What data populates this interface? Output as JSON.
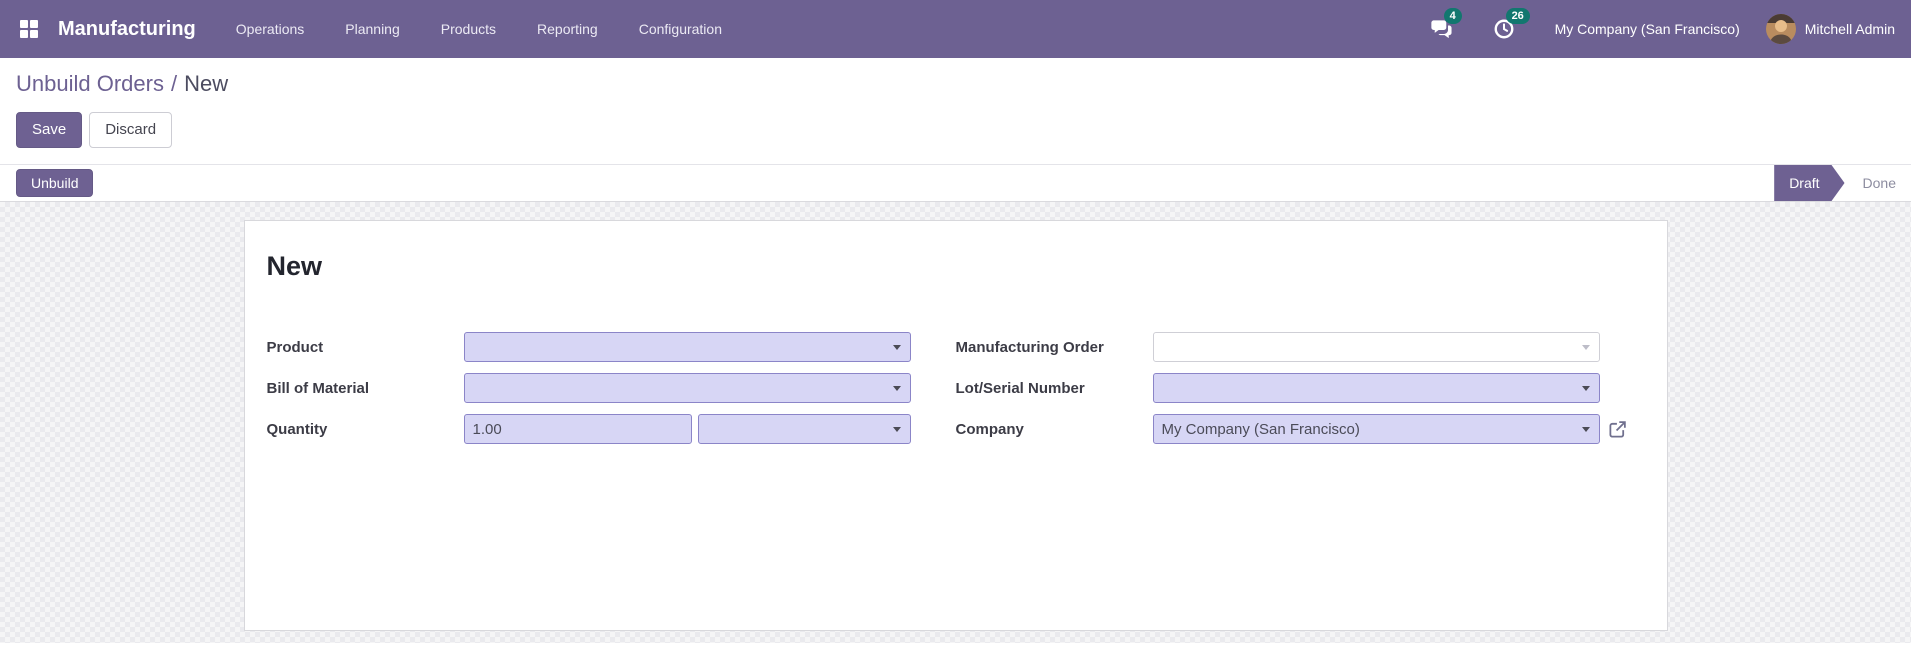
{
  "navbar": {
    "app_name": "Manufacturing",
    "menu_items": [
      "Operations",
      "Planning",
      "Products",
      "Reporting",
      "Configuration"
    ],
    "messages_badge": "4",
    "activities_badge": "26",
    "company_name": "My Company (San Francisco)",
    "user_name": "Mitchell Admin"
  },
  "icons": {
    "apps": "apps-grid-icon",
    "messages": "chat-bubbles-icon",
    "activities": "clock-icon",
    "dropdown": "chevron-down-icon",
    "company_external": "external-link-icon"
  },
  "breadcrumb": {
    "parent": "Unbuild Orders",
    "separator": "/",
    "current": "New"
  },
  "actions": {
    "save": "Save",
    "discard": "Discard"
  },
  "statusbar": {
    "action_button": "Unbuild",
    "states": [
      {
        "label": "Draft",
        "active": true
      },
      {
        "label": "Done",
        "active": false
      }
    ]
  },
  "form": {
    "title": "New",
    "fields": {
      "product": {
        "label": "Product",
        "value": ""
      },
      "bill_of_material": {
        "label": "Bill of Material",
        "value": ""
      },
      "quantity": {
        "label": "Quantity",
        "value": "1.00",
        "uom_value": ""
      },
      "manufacturing_order": {
        "label": "Manufacturing Order",
        "value": "",
        "disabled": true
      },
      "lot_serial_number": {
        "label": "Lot/Serial Number",
        "value": ""
      },
      "company": {
        "label": "Company",
        "value": "My Company (San Francisco)"
      }
    }
  },
  "colors": {
    "navbar_bg": "#6d6192",
    "primary_button": "#6e6192",
    "badge": "#12776f",
    "required_field_bg": "#d7d6f5",
    "required_field_border": "#8b85c8",
    "breadcrumb_link": "#6d6192"
  }
}
